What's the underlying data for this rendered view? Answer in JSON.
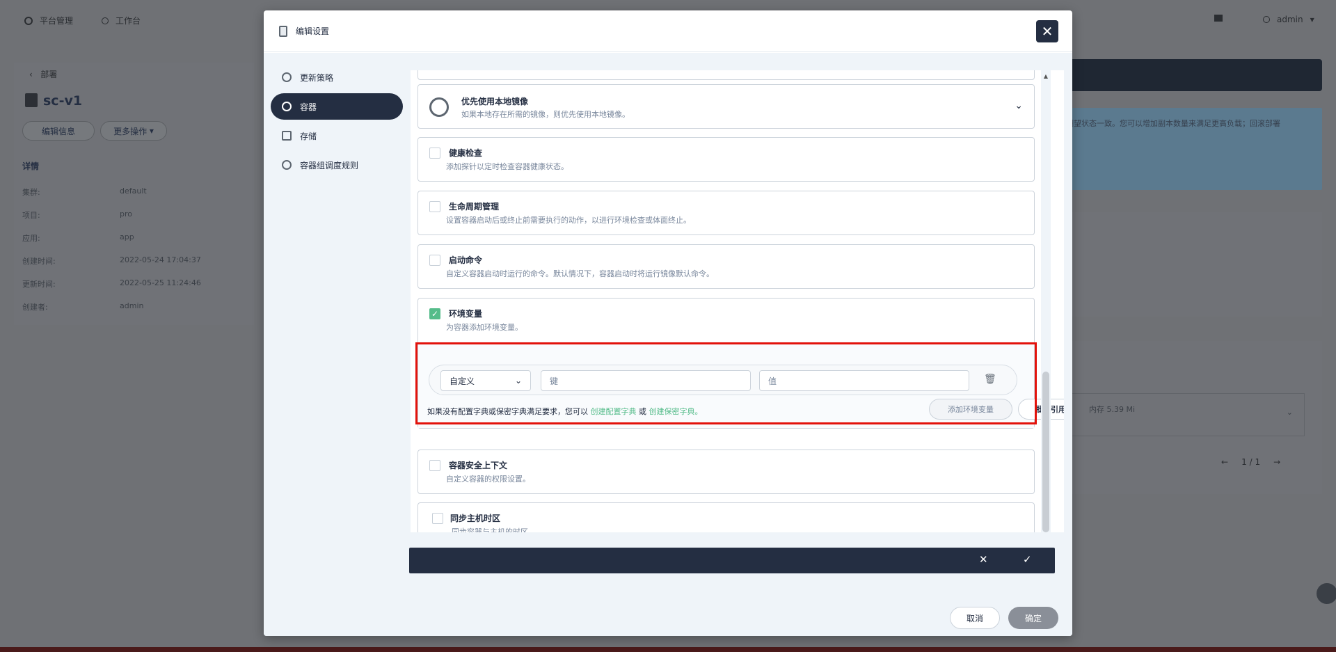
{
  "background": {
    "nav_platform": "平台管理",
    "nav_workbench": "工作台",
    "user": "admin",
    "back_label": "部署",
    "app_name": "sc-v1",
    "edit_info": "编辑信息",
    "more_actions": "更多操作",
    "details_title": "详情",
    "details": [
      {
        "k": "集群:",
        "v": "default"
      },
      {
        "k": "项目:",
        "v": "pro"
      },
      {
        "k": "应用:",
        "v": "app"
      },
      {
        "k": "创建时间:",
        "v": "2022-05-24 17:04:37"
      },
      {
        "k": "更新时间:",
        "v": "2022-05-25 11:24:46"
      },
      {
        "k": "创建者:",
        "v": "admin"
      }
    ],
    "info_text": "期望状态一致。您可以增加副本数量来满足更高负载；回滚部署",
    "memory": "内存 5.39 Mi",
    "pager": "1 / 1"
  },
  "modal": {
    "title": "编辑设置",
    "sidebar": [
      {
        "label": "更新策略"
      },
      {
        "label": "容器"
      },
      {
        "label": "存储"
      },
      {
        "label": "容器组调度规则"
      }
    ],
    "cards": [
      {
        "title": "优先使用本地镜像",
        "desc": "如果本地存在所需的镜像，则优先使用本地镜像。"
      },
      {
        "title": "健康检查",
        "desc": "添加探针以定时检查容器健康状态。",
        "checked": false
      },
      {
        "title": "生命周期管理",
        "desc": "设置容器启动后或终止前需要执行的动作，以进行环境检查或体面终止。",
        "checked": false
      },
      {
        "title": "启动命令",
        "desc": "自定义容器启动时运行的命令。默认情况下，容器启动时将运行镜像默认命令。",
        "checked": false
      },
      {
        "title": "环境变量",
        "desc": "为容器添加环境变量。",
        "checked": true
      },
      {
        "title": "容器安全上下文",
        "desc": "自定义容器的权限设置。",
        "checked": false
      },
      {
        "title": "同步主机时区",
        "desc": "同步容器与主机的时区。",
        "checked": false
      }
    ],
    "env": {
      "type_value": "自定义",
      "key_placeholder": "键",
      "value_placeholder": "值",
      "hint_prefix": "如果没有配置字典或保密字典满足要求，您可以",
      "link_configmap": "创建配置字典",
      "hint_or": "或",
      "link_secret": "创建保密字典。",
      "add_button": "添加环境变量",
      "batch_button": "批量引用"
    },
    "cancel": "取消",
    "confirm": "确定"
  },
  "colors": {
    "accent": "#55bc8a",
    "dark": "#242e42",
    "highlight": "#e3120b"
  }
}
